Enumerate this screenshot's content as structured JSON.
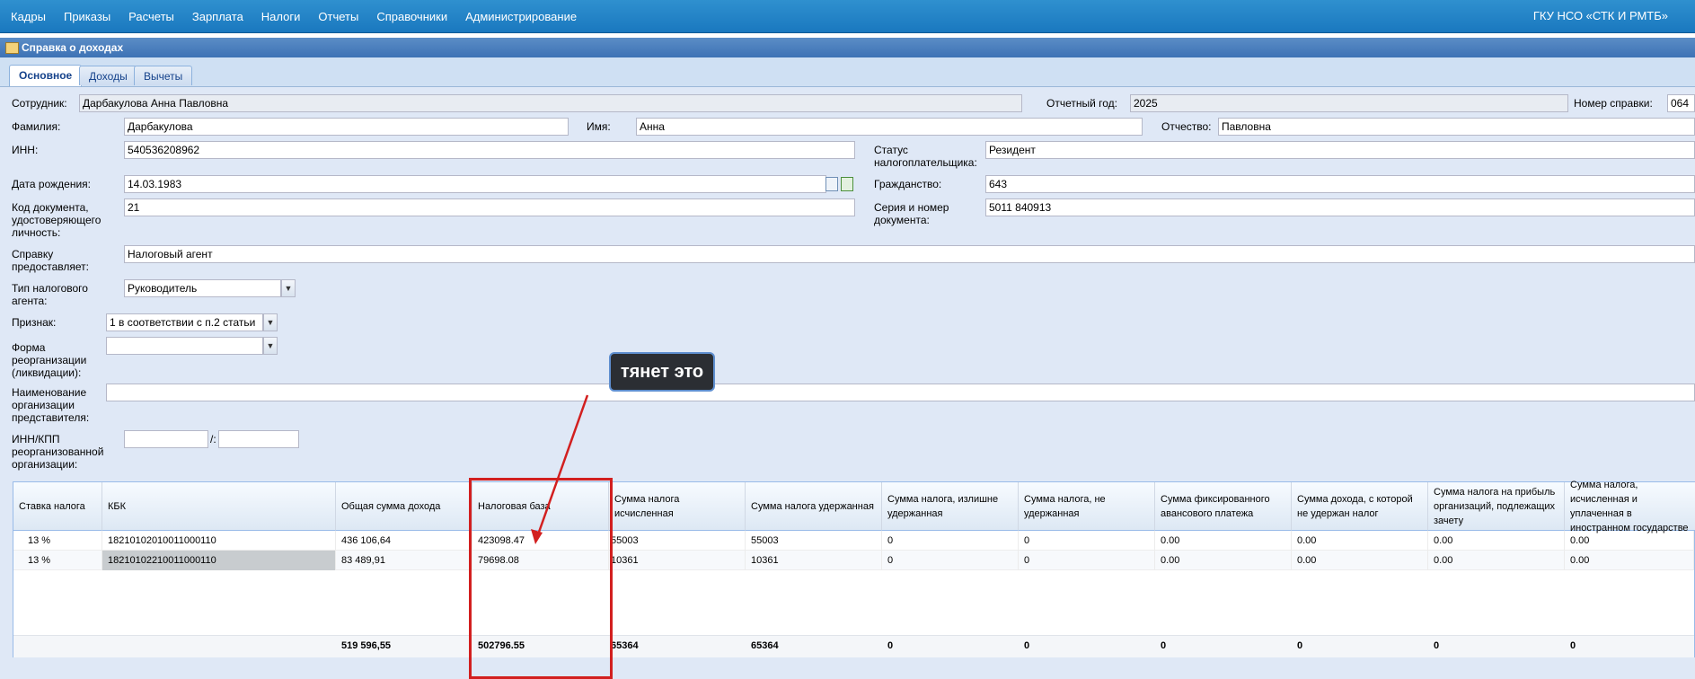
{
  "topnav": {
    "menu": [
      "Кадры",
      "Приказы",
      "Расчеты",
      "Зарплата",
      "Налоги",
      "Отчеты",
      "Справочники",
      "Администрирование"
    ],
    "org": "ГКУ НСО «СТК И РМТБ»"
  },
  "window": {
    "title": "Справка о доходах"
  },
  "tabs": [
    "Основное",
    "Доходы",
    "Вычеты"
  ],
  "form": {
    "employee_label": "Сотрудник:",
    "employee_value": "Дарбакулова Анна Павловна",
    "year_label": "Отчетный год:",
    "year_value": "2025",
    "cert_no_label": "Номер справки:",
    "cert_no_value": "064",
    "lastname_label": "Фамилия:",
    "lastname_value": "Дарбакулова",
    "firstname_label": "Имя:",
    "firstname_value": "Анна",
    "patronymic_label": "Отчество:",
    "patronymic_value": "Павловна",
    "inn_label": "ИНН:",
    "inn_value": "540536208962",
    "taxpayer_status_label_1": "Статус",
    "taxpayer_status_label_2": "налогоплательщика:",
    "taxpayer_status_value": "Резидент",
    "birthdate_label": "Дата рождения:",
    "birthdate_value": "14.03.1983",
    "citizenship_label": "Гражданство:",
    "citizenship_value": "643",
    "doc_code_label_1": "Код документа,",
    "doc_code_label_2": "удостоверяющего",
    "doc_code_label_3": "личность:",
    "doc_code_value": "21",
    "doc_series_label_1": "Серия и номер",
    "doc_series_label_2": "документа:",
    "doc_series_value": "5011 840913",
    "provider_label_1": "Справку",
    "provider_label_2": "предоставляет:",
    "provider_value": "Налоговый агент",
    "agent_type_label_1": "Тип налогового",
    "agent_type_label_2": "агента:",
    "agent_type_value": "Руководитель",
    "sign_label": "Признак:",
    "sign_value": "1 в соответствии с п.2 статьи",
    "reorg_form_label_1": "Форма",
    "reorg_form_label_2": "реорганизации",
    "reorg_form_label_3": "(ликвидации):",
    "reorg_form_value": "",
    "rep_org_label_1": "Наименование",
    "rep_org_label_2": "организации",
    "rep_org_label_3": "представителя:",
    "rep_org_value": "",
    "innkpp_label_1": "ИНН/КПП",
    "innkpp_label_2": "реорганизованной",
    "innkpp_label_3": "организации:",
    "innkpp_sep": "/:",
    "inn_reorg_value": "",
    "kpp_reorg_value": ""
  },
  "grid": {
    "headers": [
      "Ставка налога",
      "КБК",
      "Общая сумма дохода",
      "Налоговая база",
      "Сумма налога исчисленная",
      "Сумма налога удержанная",
      "Сумма налога, излишне удержанная",
      "Сумма налога, не удержанная",
      "Сумма фиксированного авансового платежа",
      "Сумма дохода, с которой не удержан налог",
      "Сумма налога на прибыль организаций, подлежащих зачету",
      "Сумма налога, исчисленная и уплаченная в иностранном государстве"
    ],
    "rows": [
      [
        "13 %",
        "18210102010011000110",
        "436 106,64",
        "423098.47",
        "55003",
        "55003",
        "0",
        "0",
        "0.00",
        "0.00",
        "0.00",
        "0.00"
      ],
      [
        "13 %",
        "18210102210011000110",
        "83 489,91",
        "79698.08",
        "10361",
        "10361",
        "0",
        "0",
        "0.00",
        "0.00",
        "0.00",
        "0.00"
      ]
    ],
    "totals": [
      "",
      "",
      "519 596,55",
      "502796.55",
      "65364",
      "65364",
      "0",
      "0",
      "0",
      "0",
      "0",
      "0"
    ]
  },
  "annotation": {
    "callout": "тянет это"
  },
  "colors": {
    "nav": "#1a78bf",
    "form_bg": "#dfe8f6",
    "annotation_red": "#d21f1f"
  }
}
